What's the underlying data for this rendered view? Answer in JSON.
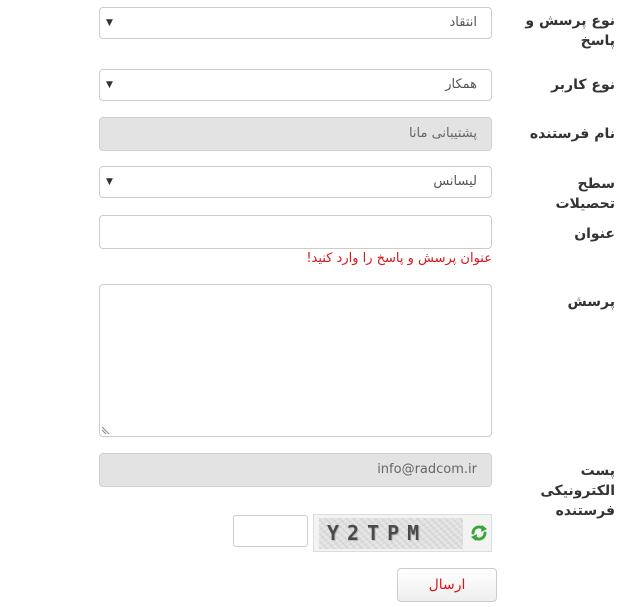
{
  "form": {
    "question_type": {
      "label": "نوع پرسش و پاسخ",
      "value": "انتقاد"
    },
    "user_type": {
      "label": "نوع کاربر",
      "value": "همکار"
    },
    "sender_name": {
      "label": "نام فرستنده",
      "value": "پشتیبانی مانا"
    },
    "education_level": {
      "label": "سطح تحصیلات",
      "value": "لیسانس"
    },
    "subject": {
      "label": "عنوان",
      "value": "",
      "error": "عنوان پرسش و پاسخ را وارد کنید!"
    },
    "question": {
      "label": "پرسش",
      "value": ""
    },
    "sender_email": {
      "label": "پست الکترونیکی فرستنده",
      "value": "info@radcom.ir"
    },
    "captcha": {
      "text": "Y2TPM",
      "input_value": "",
      "refresh_icon": "refresh-icon"
    },
    "submit_label": "ارسال"
  },
  "colors": {
    "error": "#d9161c",
    "disabled_background": "#e3e3e3",
    "border": "#cccccc",
    "refresh_icon": "#3aa63a",
    "submit_text": "#d9161c"
  },
  "icons": {
    "dropdown": "triangle-down",
    "resize": "resize-grip",
    "captcha_refresh": "refresh-icon"
  }
}
